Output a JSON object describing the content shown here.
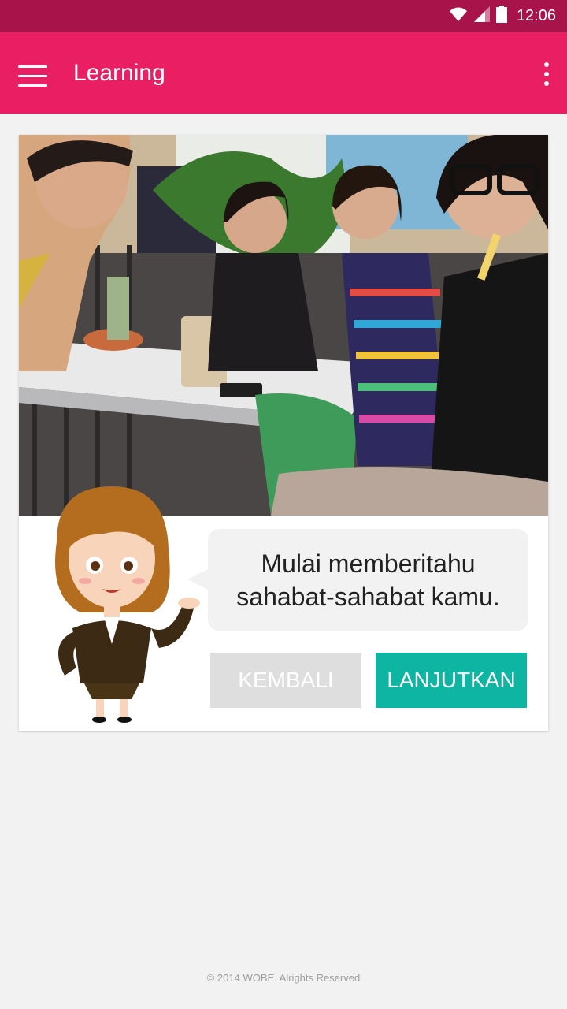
{
  "status_bar": {
    "time": "12:06",
    "icons": [
      "wifi-icon",
      "signal-icon",
      "battery-icon"
    ]
  },
  "app_bar": {
    "title": "Learning",
    "menu_icon": "hamburger-menu-icon",
    "overflow_icon": "more-vert-icon"
  },
  "colors": {
    "status_bar": "#a8144a",
    "app_bar": "#e91e63",
    "primary_button": "#0eb5a2",
    "secondary_button": "#dedede",
    "background": "#f2f2f2"
  },
  "lesson": {
    "speech_text": "Mulai memberitahu\nsahabat-sahabat kamu.",
    "back_label": "KEMBALI",
    "next_label": "LANJUTKAN"
  },
  "footer": {
    "copyright": "© 2014 WOBE. Alrights Reserved"
  }
}
